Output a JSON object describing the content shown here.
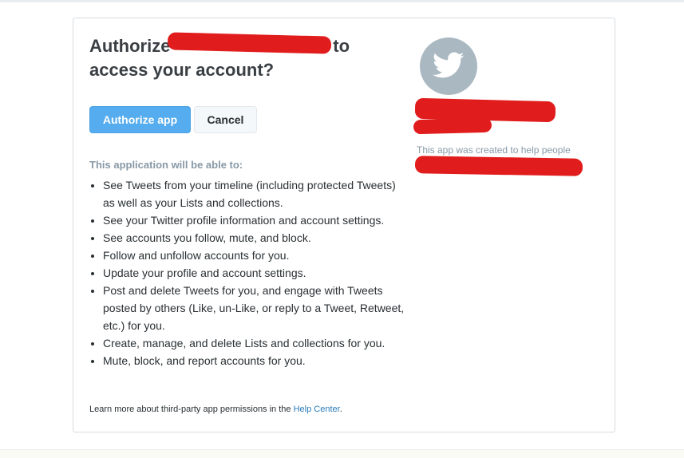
{
  "dialog": {
    "title_part1": "Authorize",
    "title_part2": "r to",
    "title_part3": "access your account?"
  },
  "buttons": {
    "authorize_label": "Authorize app",
    "cancel_label": "Cancel"
  },
  "permissions": {
    "heading": "This application will be able to:",
    "items": [
      "See Tweets from your timeline (including protected Tweets) as well as your Lists and collections.",
      "See your Twitter profile information and account settings.",
      "See accounts you follow, mute, and block.",
      "Follow and unfollow accounts for you.",
      "Update your profile and account settings.",
      "Post and delete Tweets for you, and engage with Tweets posted by others (Like, un-Like, or reply to a Tweet, Retweet, etc.) for you.",
      "Create, manage, and delete Lists and collections for you.",
      "Mute, block, and report accounts for you."
    ]
  },
  "footer": {
    "learn_more_text": "Learn more about third-party app permissions in the",
    "help_center_link": "Help Center",
    "trailing_period": "."
  },
  "app_info": {
    "avatar_icon": "twitter-bird-icon",
    "description": "This app was created to help people"
  },
  "colors": {
    "authorize_button": "#55acee",
    "redaction": "#e11c1c",
    "link": "#2b7bb9"
  }
}
